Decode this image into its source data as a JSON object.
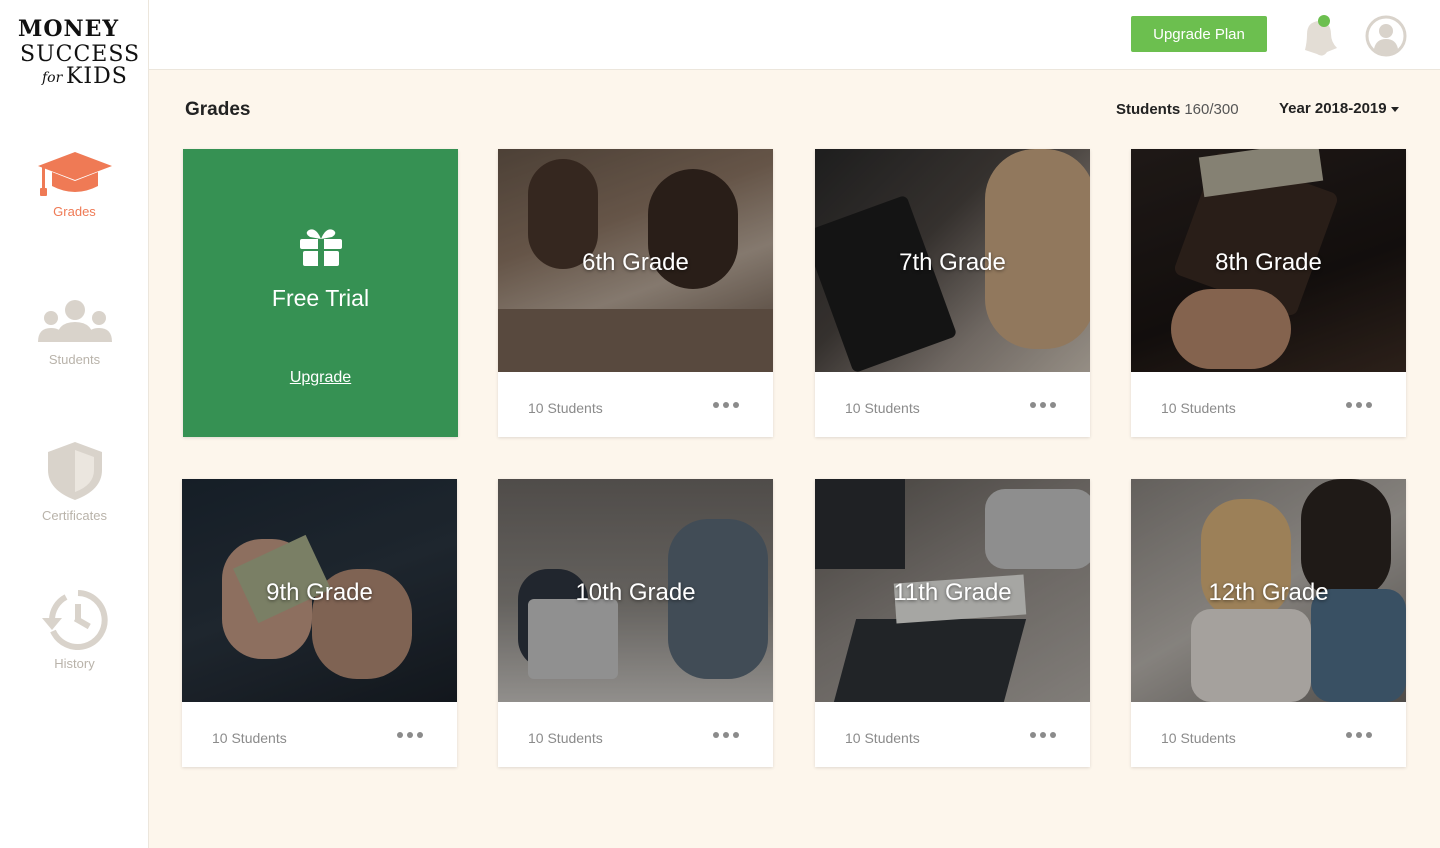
{
  "logo": {
    "line1": "MONEY",
    "line2": "SUCCESS",
    "line3a": "for",
    "line3b": "KIDS"
  },
  "sidebar": {
    "items": [
      {
        "label": "Grades",
        "icon": "graduation-cap-icon",
        "active": true
      },
      {
        "label": "Students",
        "icon": "users-icon",
        "active": false
      },
      {
        "label": "Certificates",
        "icon": "shield-icon",
        "active": false
      },
      {
        "label": "History",
        "icon": "history-icon",
        "active": false
      }
    ]
  },
  "topbar": {
    "upgrade_label": "Upgrade Plan"
  },
  "main": {
    "title": "Grades",
    "students_label": "Students",
    "students_value": "160/300",
    "year_label": "Year 2018-2019"
  },
  "trial": {
    "title": "Free Trial",
    "link": "Upgrade"
  },
  "grades": [
    {
      "title": "6th Grade",
      "students": "10 Students"
    },
    {
      "title": "7th Grade",
      "students": "10 Students"
    },
    {
      "title": "8th Grade",
      "students": "10 Students"
    },
    {
      "title": "9th Grade",
      "students": "10 Students"
    },
    {
      "title": "10th Grade",
      "students": "10 Students"
    },
    {
      "title": "11th Grade",
      "students": "10 Students"
    },
    {
      "title": "12th Grade",
      "students": "10 Students"
    }
  ],
  "colors": {
    "accent": "#ef7a55",
    "upgrade_button": "#6cbf4f",
    "trial_card": "#369153",
    "background": "#fdf6ec",
    "notification_dot": "#6cbf4f"
  }
}
